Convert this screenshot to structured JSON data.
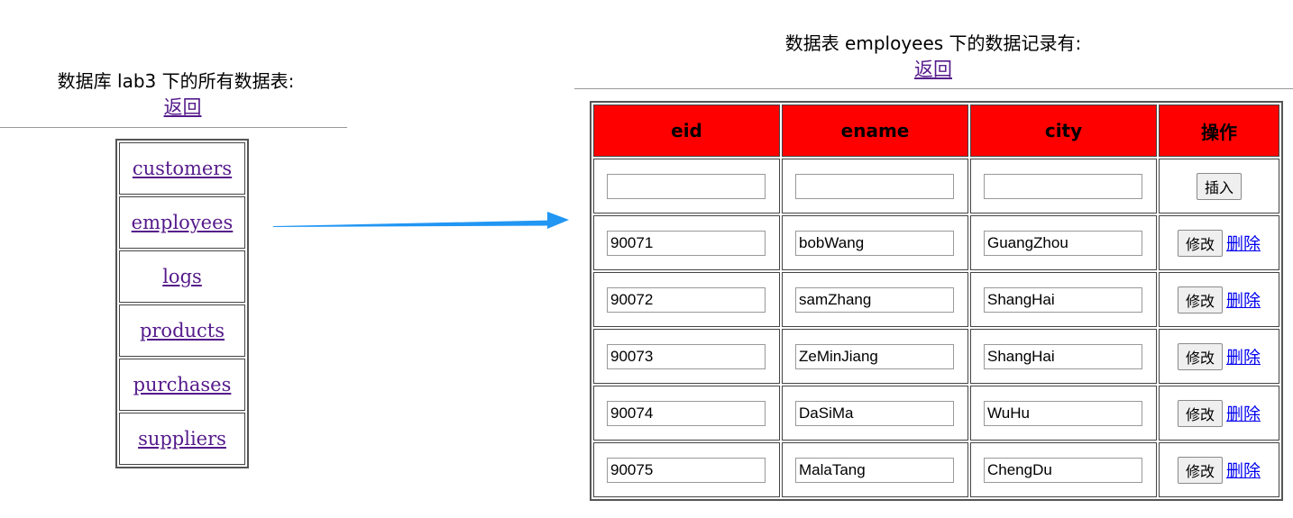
{
  "left": {
    "title": "数据库 lab3 下的所有数据表:",
    "back_label": "返回",
    "tables": [
      "customers",
      "employees",
      "logs",
      "products",
      "purchases",
      "suppliers"
    ]
  },
  "right": {
    "title": "数据表 employees 下的数据记录有:",
    "back_label": "返回",
    "header_color": "#ff0000",
    "columns": [
      "eid",
      "ename",
      "city",
      "操作"
    ],
    "insert_label": "插入",
    "edit_label": "修改",
    "delete_label": "删除",
    "rows": [
      {
        "eid": "90071",
        "ename": "bobWang",
        "city": "GuangZhou"
      },
      {
        "eid": "90072",
        "ename": "samZhang",
        "city": "ShangHai"
      },
      {
        "eid": "90073",
        "ename": "ZeMinJiang",
        "city": "ShangHai"
      },
      {
        "eid": "90074",
        "ename": "DaSiMa",
        "city": "WuHu"
      },
      {
        "eid": "90075",
        "ename": "MalaTang",
        "city": "ChengDu"
      }
    ]
  },
  "arrow_color": "#2196f3"
}
